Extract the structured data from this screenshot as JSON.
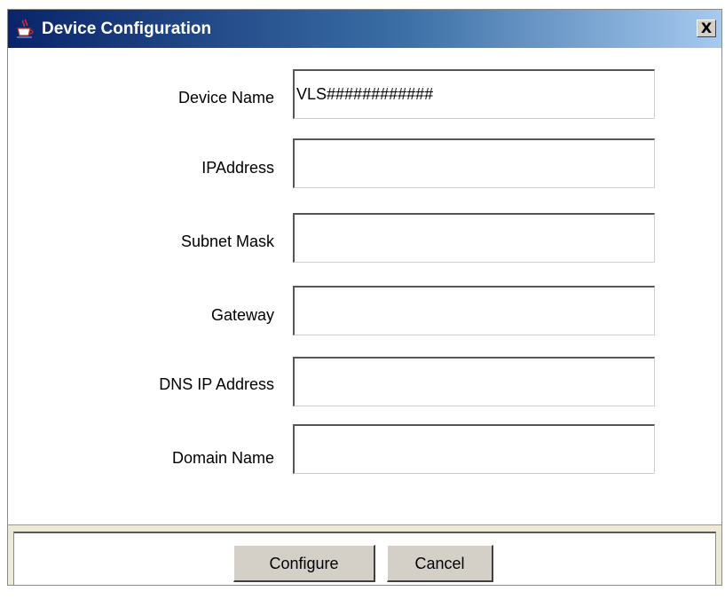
{
  "window": {
    "title": "Device Configuration",
    "close_label": "X",
    "title_icon": "java-cup-icon"
  },
  "fields": [
    {
      "label": "Device Name",
      "value": "VLS############"
    },
    {
      "label": "IPAddress",
      "value": ""
    },
    {
      "label": "Subnet Mask",
      "value": ""
    },
    {
      "label": "Gateway",
      "value": ""
    },
    {
      "label": "DNS IP Address",
      "value": ""
    },
    {
      "label": "Domain Name",
      "value": ""
    }
  ],
  "buttons": {
    "configure_label": "Configure",
    "cancel_label": "Cancel"
  },
  "colors": {
    "titlebar_start": "#0a246a",
    "titlebar_end": "#a6caf0",
    "button_face": "#d4d0c8"
  }
}
